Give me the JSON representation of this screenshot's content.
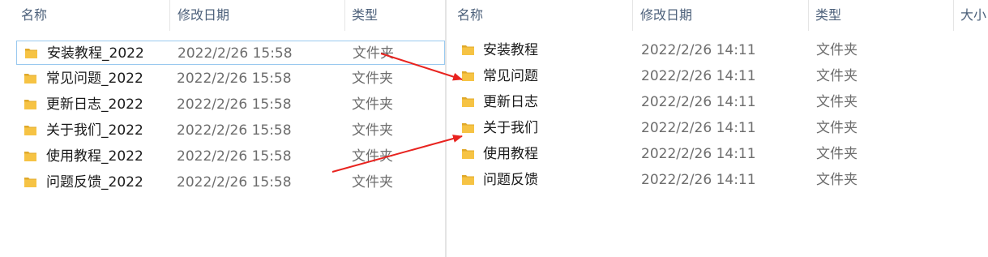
{
  "left": {
    "columns": {
      "name": "名称",
      "date": "修改日期",
      "type": "类型"
    },
    "sort_indicator": "^",
    "rows": [
      {
        "name": "安装教程_2022",
        "date": "2022/2/26 15:58",
        "type": "文件夹",
        "selected": true
      },
      {
        "name": "常见问题_2022",
        "date": "2022/2/26 15:58",
        "type": "文件夹"
      },
      {
        "name": "更新日志_2022",
        "date": "2022/2/26 15:58",
        "type": "文件夹"
      },
      {
        "name": "关于我们_2022",
        "date": "2022/2/26 15:58",
        "type": "文件夹"
      },
      {
        "name": "使用教程_2022",
        "date": "2022/2/26 15:58",
        "type": "文件夹"
      },
      {
        "name": "问题反馈_2022",
        "date": "2022/2/26 15:58",
        "type": "文件夹"
      }
    ]
  },
  "right": {
    "columns": {
      "name": "名称",
      "date": "修改日期",
      "type": "类型",
      "size": "大小"
    },
    "sort_indicator": "^",
    "rows": [
      {
        "name": "安装教程",
        "date": "2022/2/26 14:11",
        "type": "文件夹"
      },
      {
        "name": "常见问题",
        "date": "2022/2/26 14:11",
        "type": "文件夹"
      },
      {
        "name": "更新日志",
        "date": "2022/2/26 14:11",
        "type": "文件夹"
      },
      {
        "name": "关于我们",
        "date": "2022/2/26 14:11",
        "type": "文件夹"
      },
      {
        "name": "使用教程",
        "date": "2022/2/26 14:11",
        "type": "文件夹"
      },
      {
        "name": "问题反馈",
        "date": "2022/2/26 14:11",
        "type": "文件夹"
      }
    ]
  },
  "colors": {
    "folder": "#f6c344",
    "folder_dark": "#e0a92a",
    "arrow": "#e8231f",
    "selection_border": "#99c9ef"
  },
  "icons": {
    "folder": "folder-icon"
  }
}
